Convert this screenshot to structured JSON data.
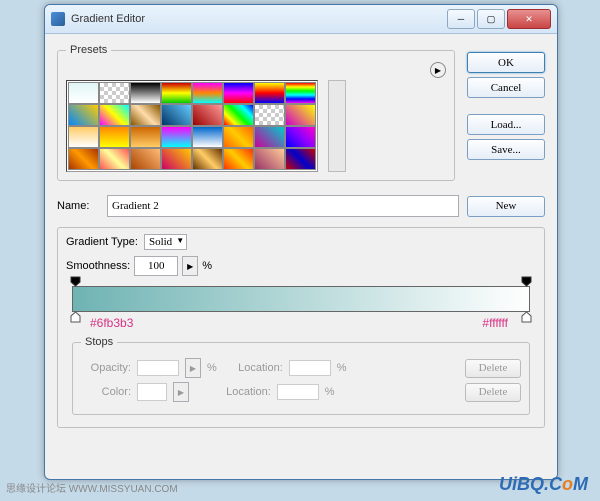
{
  "window": {
    "title": "Gradient Editor"
  },
  "presets": {
    "legend": "Presets"
  },
  "buttons": {
    "ok": "OK",
    "cancel": "Cancel",
    "load": "Load...",
    "save": "Save...",
    "new": "New",
    "delete1": "Delete",
    "delete2": "Delete"
  },
  "name": {
    "label": "Name:",
    "value": "Gradient 2"
  },
  "gtype": {
    "label": "Gradient Type:",
    "value": "Solid"
  },
  "smooth": {
    "label": "Smoothness:",
    "value": "100",
    "unit": "%"
  },
  "hex": {
    "left": "#6fb3b3",
    "right": "#ffffff"
  },
  "stops": {
    "legend": "Stops",
    "opacity": "Opacity:",
    "color": "Color:",
    "location": "Location:",
    "pct": "%"
  },
  "swatches": [
    "linear-gradient(#e0f5f5,#ffffff)",
    "repeating-conic-gradient(#ccc 0 25%,#fff 0 50%) 0 0/8px 8px",
    "linear-gradient(#000,#fff)",
    "linear-gradient(#c00,#ff0,#0c0)",
    "linear-gradient(#f0f,#f80,#0ff)",
    "linear-gradient(#00f,#f0f,#f00)",
    "linear-gradient(#ff0,#f00,#00f)",
    "linear-gradient(#f00,#ff0,#0f0,#0ff,#00f,#f0f)",
    "linear-gradient(45deg,#08f,#fc0)",
    "linear-gradient(45deg,#f0f,#ff0,#0ff)",
    "linear-gradient(45deg,#850,#fda,#850)",
    "linear-gradient(45deg,#036,#6cf)",
    "linear-gradient(45deg,#900,#f99)",
    "linear-gradient(45deg,#f00,#ff0,#0f0,#0ff,#00f)",
    "repeating-conic-gradient(#ccc 0 25%,#fff 0 50%) 0 0/8px 8px",
    "linear-gradient(45deg,#c0c,#ff0)",
    "linear-gradient(#fc6,#fff)",
    "linear-gradient(#f80,#ff0)",
    "linear-gradient(#c60,#fc6)",
    "linear-gradient(#f0f,#0ff)",
    "linear-gradient(#06c,#fff)",
    "linear-gradient(45deg,#f60,#fc0,#f60)",
    "linear-gradient(45deg,#c09,#0cc)",
    "linear-gradient(45deg,#00f,#80f,#f0c)",
    "linear-gradient(45deg,#a30,#f90,#a30)",
    "linear-gradient(45deg,#f55,#ff9,#f55)",
    "linear-gradient(45deg,#a40,#fb7)",
    "linear-gradient(45deg,#c06,#fc0)",
    "linear-gradient(45deg,#630,#fc6,#630)",
    "linear-gradient(45deg,#f30,#fc0,#f30)",
    "linear-gradient(45deg,#936,#fc9)",
    "linear-gradient(45deg,#c00,#00c,#c00)"
  ]
}
